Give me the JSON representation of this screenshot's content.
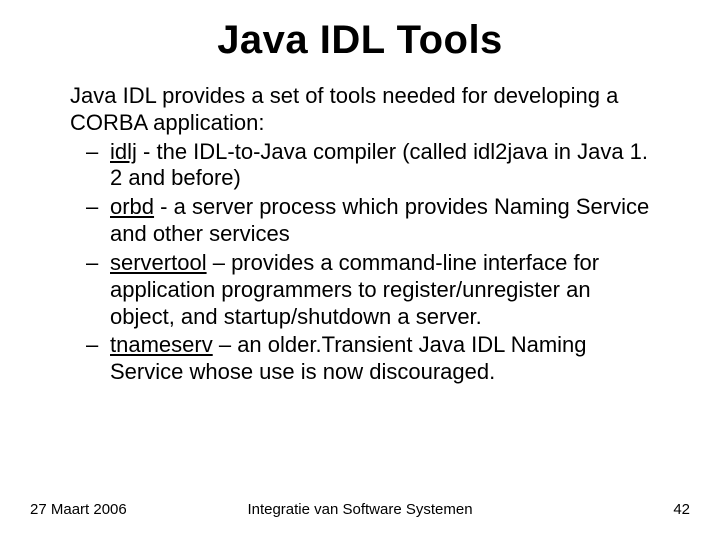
{
  "title": "Java IDL Tools",
  "intro": "Java IDL provides a set of tools needed for developing a CORBA application:",
  "bullets": [
    {
      "tool": "idlj",
      "sep": " - ",
      "desc": "the IDL-to-Java compiler (called idl2java in Java 1. 2 and before)"
    },
    {
      "tool": " orbd",
      "sep": " - ",
      "desc": "a server process which provides Naming Service and other services"
    },
    {
      "tool": "servertool",
      "sep": " – ",
      "desc": "provides a command-line interface for application programmers to register/unregister an object,  and startup/shutdown a server."
    },
    {
      "tool": "tnameserv",
      "sep": " – ",
      "desc": "an older.Transient Java IDL Naming Service whose use is now discouraged."
    }
  ],
  "footer": {
    "date": "27 Maart 2006",
    "center": "Integratie van Software Systemen",
    "page": "42"
  }
}
